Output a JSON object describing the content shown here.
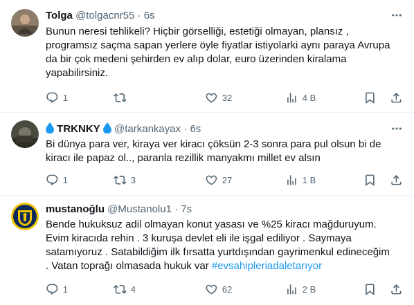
{
  "tweets": [
    {
      "name": "Tolga",
      "handle": "@tolgacnr55",
      "separator": "·",
      "time": "6s",
      "lines": [
        "Bunun neresi tehlikeli? Hiçbir görselliği, estetiği olmayan, plansız ,",
        "programsız saçma sapan yerlere öyle fiyatlar istiyolarki aynı paraya Avrupa",
        "da bir çok medeni şehirden ev alıp dolar, euro üzerinden kiralama",
        "yapabilirsiniz."
      ],
      "replies": "1",
      "retweets": "",
      "likes": "32",
      "views": "4 B"
    },
    {
      "name": "TRKNKY",
      "handle": "@tarkankayax",
      "separator": "·",
      "time": "6s",
      "lines": [
        "Bi dünya para ver, kiraya ver kiracı çöksün 2-3 sonra para pul olsun bi de",
        "kiracı ile papaz ol.., paranla rezillik manyakmı millet ev alsın"
      ],
      "replies": "1",
      "retweets": "3",
      "likes": "27",
      "views": "1 B"
    },
    {
      "name": "mustanoğlu",
      "handle": "@Mustanolu1",
      "separator": "·",
      "time": "7s",
      "lines": [
        "Bende hukuksuz adil olmayan konut yasası ve %25 kiracı mağduruyum.",
        "Evim kiracıda rehin . 3 kuruşa devlet eli ile işgal ediliyor . Saymaya",
        "satamıyoruz . Satabildiğim ilk fırsatta yurtdışından gayrimenkul edineceğim",
        ". Vatan toprağı olmasada hukuk var "
      ],
      "hashtag": "#evsahipleriadaletarıyor",
      "replies": "1",
      "retweets": "4",
      "likes": "62",
      "views": "2 B"
    }
  ],
  "icons": {
    "more": "more-horizontal-icon",
    "reply": "reply-icon",
    "retweet": "retweet-icon",
    "like": "heart-icon",
    "views": "views-icon",
    "bookmark": "bookmark-icon",
    "share": "share-icon",
    "drop": "water-drop-icon"
  },
  "colors": {
    "text": "#0f1419",
    "secondary": "#536471",
    "hashtag": "#1d9bf0",
    "divider": "#eff3f4",
    "drop": "#1d9bf0"
  }
}
